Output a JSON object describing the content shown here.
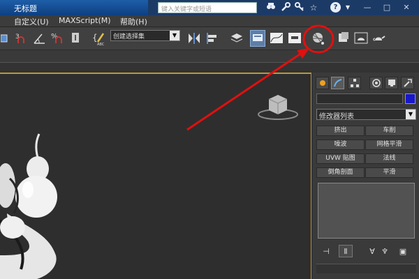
{
  "window": {
    "title": "无标题",
    "search_placeholder": "键入关键字或短语"
  },
  "menubar": {
    "items": [
      "自定义(U)",
      "MAXScript(M)",
      "帮助(H)"
    ]
  },
  "toolbar": {
    "selection_set": "创建选择集",
    "highlighted_tool": "render-setup-teapot-button"
  },
  "command_panel": {
    "modifier_list": "修改器列表",
    "modifier_buttons": [
      "挤出",
      "车削",
      "噪波",
      "网格平滑",
      "UVW 贴图",
      "法线",
      "倒角剖面",
      "平滑"
    ],
    "swatch_color": "#1818c8"
  },
  "annotation": {
    "color": "#e01010"
  },
  "colors": {
    "viewport_border": "#b89a3a",
    "title_bar": "#1e5ea8"
  }
}
